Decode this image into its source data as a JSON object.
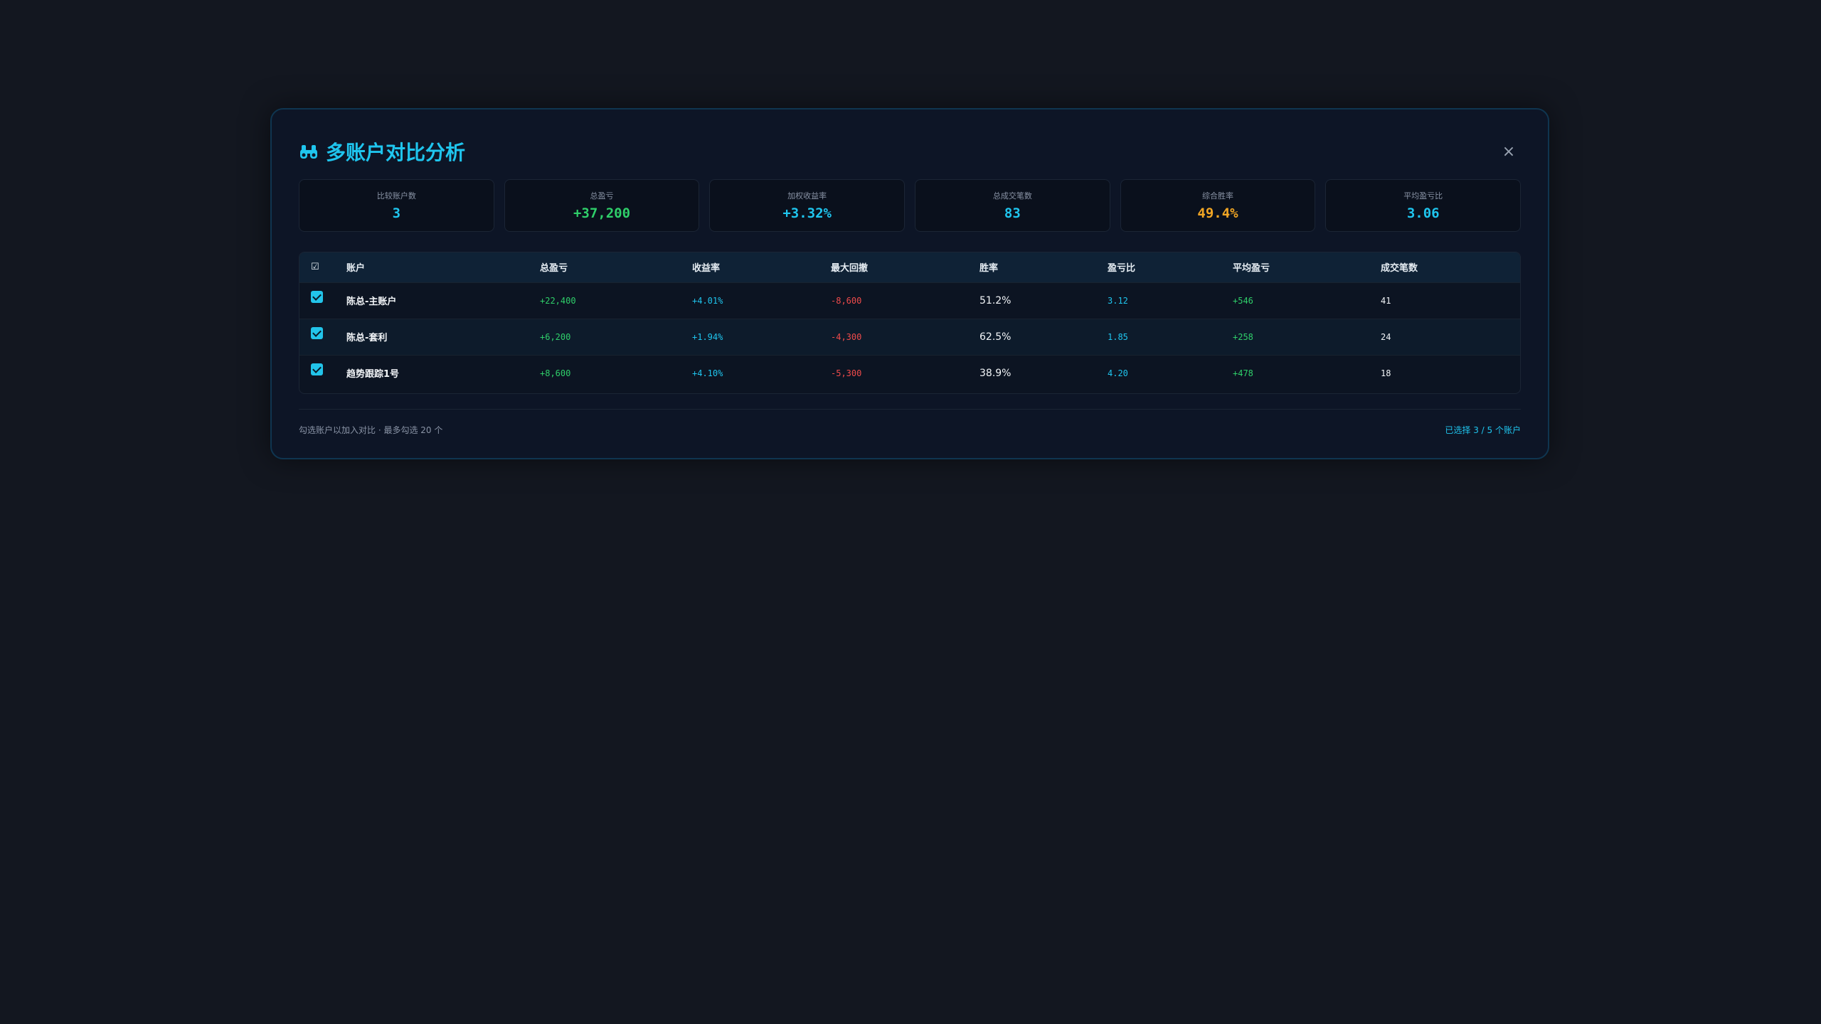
{
  "modal": {
    "title": "多账户对比分析",
    "title_icon": "binoculars-icon",
    "close_label": "×"
  },
  "stats": [
    {
      "label": "比较账户数",
      "value": "3",
      "color": "#1fc5ee"
    },
    {
      "label": "总盈亏",
      "value": "+37,200",
      "color": "#2fcf6a"
    },
    {
      "label": "加权收益率",
      "value": "+3.32%",
      "color": "#1fc5ee"
    },
    {
      "label": "总成交笔数",
      "value": "83",
      "color": "#1fc5ee"
    },
    {
      "label": "综合胜率",
      "value": "49.4%",
      "color": "#f2a624"
    },
    {
      "label": "平均盈亏比",
      "value": "3.06",
      "color": "#1fc5ee"
    }
  ],
  "table": {
    "header_checkbox": "☑",
    "columns": [
      "账户",
      "总盈亏",
      "收益率",
      "最大回撤",
      "胜率",
      "盈亏比",
      "平均盈亏",
      "成交笔数"
    ],
    "rows": [
      {
        "checked": true,
        "account": "陈总-主账户",
        "total_pnl": "+22,400",
        "return": "+4.01%",
        "max_drawdown": "-8,600",
        "win_rate": "51.2%",
        "pl_ratio": "3.12",
        "avg_pnl": "+546",
        "trades": "41"
      },
      {
        "checked": true,
        "account": "陈总-套利",
        "total_pnl": "+6,200",
        "return": "+1.94%",
        "max_drawdown": "-4,300",
        "win_rate": "62.5%",
        "pl_ratio": "1.85",
        "avg_pnl": "+258",
        "trades": "24"
      },
      {
        "checked": true,
        "account": "趋势跟踪1号",
        "total_pnl": "+8,600",
        "return": "+4.10%",
        "max_drawdown": "-5,300",
        "win_rate": "38.9%",
        "pl_ratio": "4.20",
        "avg_pnl": "+478",
        "trades": "18"
      }
    ]
  },
  "footer": {
    "hint": "勾选账户以加入对比 · 最多勾选 20 个",
    "selection": "已选择 3 / 5 个账户"
  },
  "colors": {
    "accent": "#1fc5ee",
    "positive": "#2fcf6a",
    "negative": "#ef4b4b",
    "warning": "#f2a624"
  }
}
